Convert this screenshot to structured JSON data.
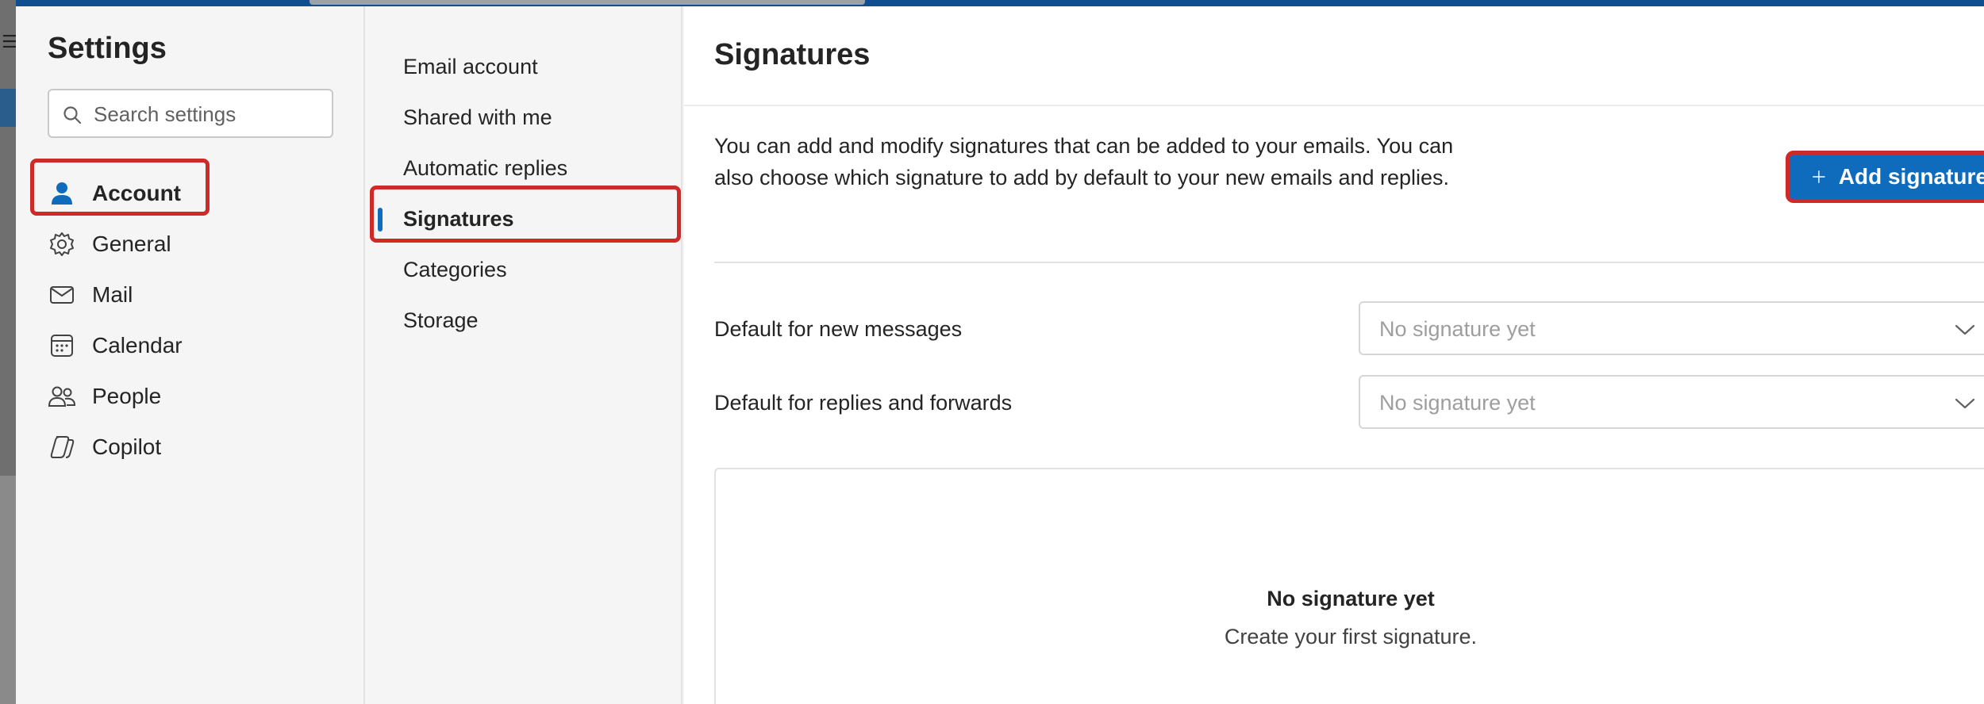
{
  "settings": {
    "title": "Settings",
    "search_placeholder": "Search settings",
    "nav": [
      {
        "label": "Account",
        "icon": "person-icon",
        "selected": true
      },
      {
        "label": "General",
        "icon": "gear-icon",
        "selected": false
      },
      {
        "label": "Mail",
        "icon": "mail-icon",
        "selected": false
      },
      {
        "label": "Calendar",
        "icon": "calendar-icon",
        "selected": false
      },
      {
        "label": "People",
        "icon": "people-icon",
        "selected": false
      },
      {
        "label": "Copilot",
        "icon": "copilot-icon",
        "selected": false
      }
    ]
  },
  "account_nav": [
    {
      "label": "Email account",
      "selected": false
    },
    {
      "label": "Shared with me",
      "selected": false
    },
    {
      "label": "Automatic replies",
      "selected": false
    },
    {
      "label": "Signatures",
      "selected": true
    },
    {
      "label": "Categories",
      "selected": false
    },
    {
      "label": "Storage",
      "selected": false
    }
  ],
  "signatures": {
    "title": "Signatures",
    "description": "You can add and modify signatures that can be added to your emails. You can also choose which signature to add by default to your new emails and replies.",
    "add_button": "Add signature",
    "default_new_label": "Default for new messages",
    "default_new_value": "No signature yet",
    "default_reply_label": "Default for replies and forwards",
    "default_reply_value": "No signature yet",
    "empty_title": "No signature yet",
    "empty_subtitle": "Create your first signature."
  },
  "colors": {
    "accent": "#0f6cbd",
    "highlight_outline": "#cc2b27"
  }
}
